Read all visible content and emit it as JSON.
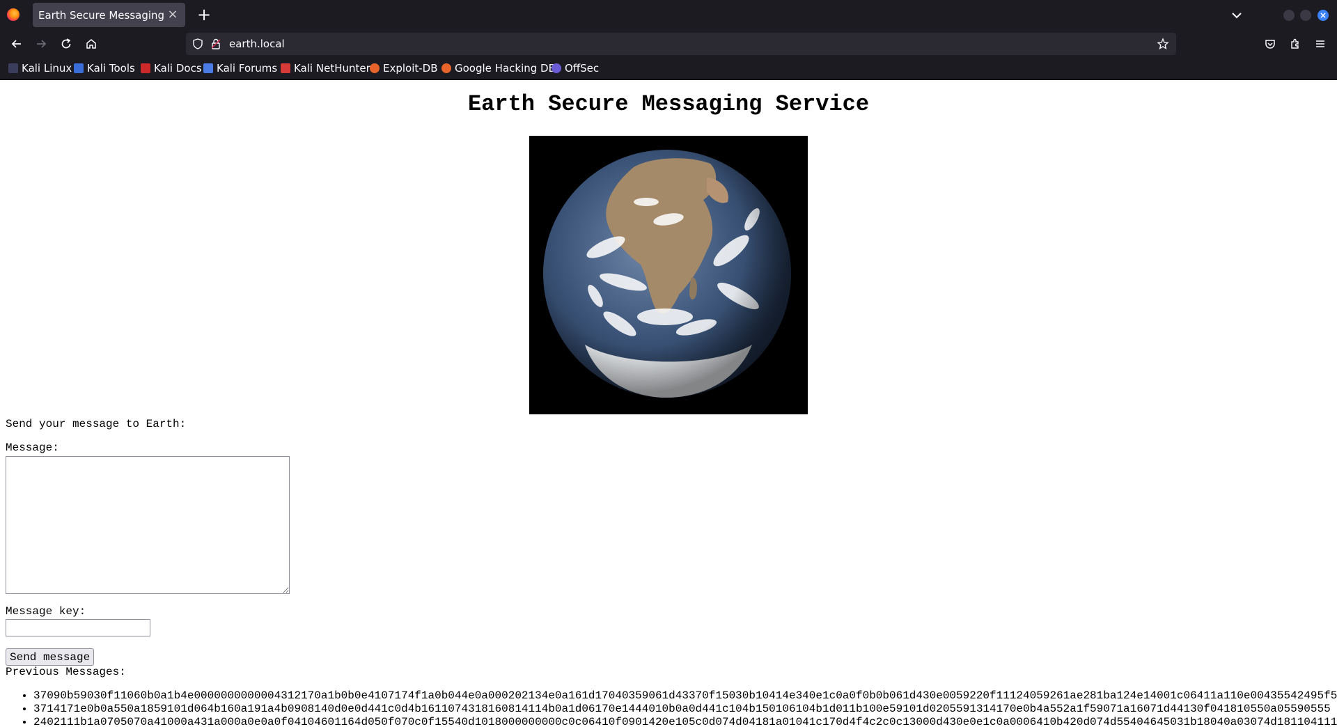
{
  "browser": {
    "tab": {
      "title": "Earth Secure Messaging",
      "close_icon": "close-icon"
    },
    "url": "earth.local",
    "bookmarks": [
      {
        "label": "Kali Linux",
        "color": "#2d3250"
      },
      {
        "label": "Kali Tools",
        "color": "#3b6dd8"
      },
      {
        "label": "Kali Docs",
        "color": "#cc2a2a"
      },
      {
        "label": "Kali Forums",
        "color": "#4b7be5"
      },
      {
        "label": "Kali NetHunter",
        "color": "#d83a3a"
      },
      {
        "label": "Exploit-DB",
        "color": "#e8642b"
      },
      {
        "label": "Google Hacking DB",
        "color": "#e8642b"
      },
      {
        "label": "OffSec",
        "color": "#6b5bd6"
      }
    ]
  },
  "page": {
    "title": "Earth Secure Messaging Service",
    "image_alt": "Earth",
    "send_prompt": "Send your message to Earth:",
    "message_label": "Message:",
    "message_value": "",
    "key_label": "Message key:",
    "key_value": "",
    "send_button": "Send message",
    "previous_label": "Previous Messages:",
    "messages": [
      "37090b59030f11060b0a1b4e0000000000004312170a1b0b0e4107174f1a0b044e0a000202134e0a161d17040359061d43370f15030b10414e340e1c0a0f0b0b061d430e0059220f11124059261ae281ba124e14001c06411a110e00435542495f5",
      "3714171e0b0a550a1859101d064b160a191a4b0908140d0e0d441c0d4b1611074318160814114b0a1d06170e1444010b0a0d441c104b150106104b1d011b100e59101d0205591314170e0b4a552a1f59071a16071d44130f041810550a05590555",
      "2402111b1a0705070a41000a431a000a0e0a0f04104601164d050f070c0f15540d1018000000000c0c06410f0901420e105c0d074d04181a01041c170d4f4c2c0c13000d430e0e1c0a0006410b420d074d55404645031b18040a03074d181104111"
    ]
  }
}
